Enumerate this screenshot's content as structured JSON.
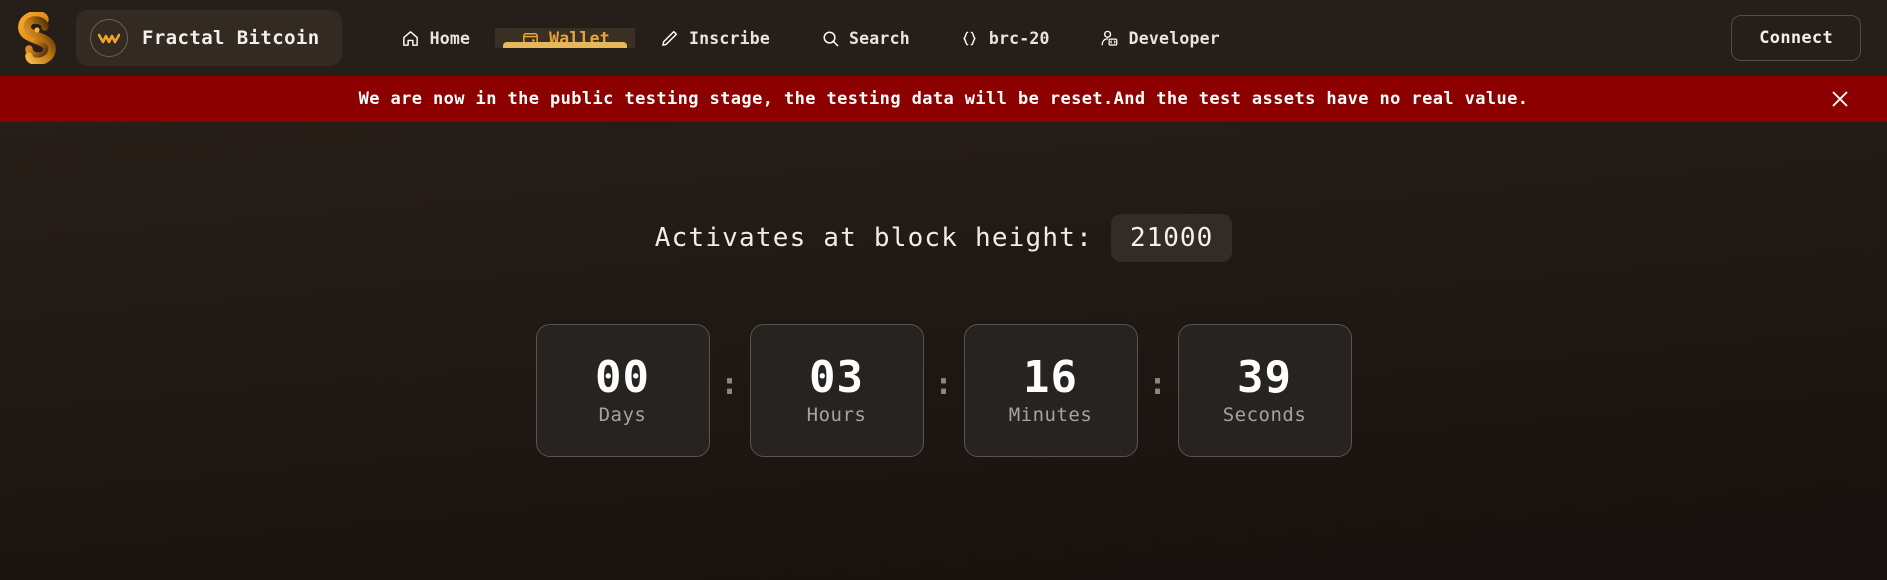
{
  "navbar": {
    "logo_icon": "fractal-ouroboros-logo",
    "brand": {
      "coin_icon": "fractal-coin-icon",
      "name": "Fractal Bitcoin"
    },
    "items": [
      {
        "label": "Home",
        "icon": "home-icon",
        "active": false
      },
      {
        "label": "Wallet",
        "icon": "wallet-icon",
        "active": true
      },
      {
        "label": "Inscribe",
        "icon": "pencil-icon",
        "active": false
      },
      {
        "label": "Search",
        "icon": "search-icon",
        "active": false
      },
      {
        "label": "brc-20",
        "icon": "braces-icon",
        "active": false
      },
      {
        "label": "Developer",
        "icon": "developer-icon",
        "active": false
      }
    ],
    "connect_label": "Connect",
    "active_accent_color": "#e7b75c",
    "active_text_color": "#e9a33a"
  },
  "banner": {
    "message": "We are now in the public testing stage, the testing data will be reset.And the test assets have no real value.",
    "close_icon": "close-icon",
    "background_color": "#8d0000"
  },
  "main": {
    "activation_label": "Activates at block height:",
    "block_height": "21000",
    "separator": ":",
    "countdown": [
      {
        "value": "00",
        "label": "Days"
      },
      {
        "value": "03",
        "label": "Hours"
      },
      {
        "value": "16",
        "label": "Minutes"
      },
      {
        "value": "39",
        "label": "Seconds"
      }
    ]
  }
}
